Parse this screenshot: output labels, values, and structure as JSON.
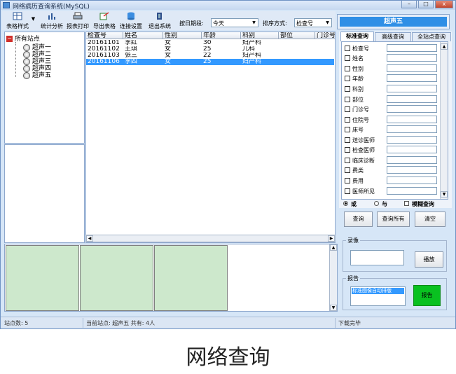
{
  "window": {
    "title": "网络病历查询系统(MySQL)",
    "buttons": {
      "minimize": "–",
      "maximize": "□",
      "close": "x"
    }
  },
  "toolbar": {
    "buttons": [
      {
        "label": "表格样式",
        "icon": "table-style-icon"
      },
      {
        "label": "统计分析",
        "icon": "bar-chart-icon"
      },
      {
        "label": "报表打印",
        "icon": "printer-icon"
      },
      {
        "label": "导出表格",
        "icon": "export-icon"
      },
      {
        "label": "连接设置",
        "icon": "database-icon"
      },
      {
        "label": "退出系统",
        "icon": "exit-icon"
      }
    ],
    "date_label": "按日期段:",
    "date_value": "今天",
    "sort_label": "排序方式:",
    "sort_value": "检查号"
  },
  "station": {
    "name": "超声五"
  },
  "tree": {
    "root": "所有站点",
    "items": [
      "超声一",
      "超声二",
      "超声三",
      "超声四",
      "超声五"
    ]
  },
  "table": {
    "columns": [
      "检查号",
      "姓名",
      "性别",
      "年龄",
      "科别",
      "部位",
      "门诊号"
    ],
    "rows": [
      [
        "20161101",
        "李红",
        "女",
        "30",
        "妇产科",
        "",
        ""
      ],
      [
        "20161102",
        "王琪",
        "女",
        "25",
        "儿科",
        "",
        ""
      ],
      [
        "20161103",
        "张三",
        "女",
        "22",
        "妇产科",
        "",
        ""
      ],
      [
        "20161106",
        "李四",
        "女",
        "25",
        "妇产科",
        "",
        ""
      ]
    ],
    "selected_row": 3
  },
  "query": {
    "tabs": [
      "标准查询",
      "高级查询",
      "全站点查询"
    ],
    "active_tab": 0,
    "fields": [
      "检查号",
      "姓名",
      "性别",
      "年龄",
      "科别",
      "部位",
      "门诊号",
      "住院号",
      "床号",
      "送诊医师",
      "检查医师",
      "临床诊断",
      "费类",
      "费用",
      "医师所见"
    ],
    "radio_or": "或",
    "radio_and": "与",
    "fuzzy": "模糊查询",
    "buttons": {
      "query": "查询",
      "query_all": "查询所有",
      "clear": "清空"
    }
  },
  "recording": {
    "label": "录像",
    "play": "播放"
  },
  "report": {
    "label": "报告",
    "item": "标准图像自动排版",
    "button": "报告"
  },
  "status": {
    "station_count": "站点数: 5",
    "current": "当前站点: 超声五 共有: 4人",
    "download": "下载完毕"
  },
  "caption": "网络查询",
  "colors": {
    "selection": "#3399ff",
    "station_bar": "#2f8fe6",
    "report_button": "#09c120",
    "thumbnail": "#cde8cc"
  }
}
